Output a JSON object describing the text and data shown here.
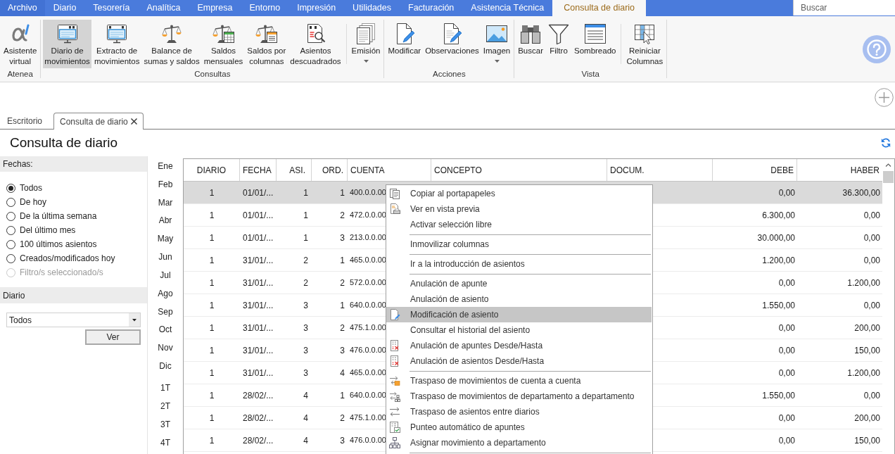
{
  "menu_bar": {
    "tabs": [
      {
        "label": "Archivo",
        "kind": "file",
        "selected": false
      },
      {
        "label": "Diario",
        "kind": "tab",
        "selected": false
      },
      {
        "label": "Tesorería",
        "kind": "tab",
        "selected": false
      },
      {
        "label": "Analítica",
        "kind": "tab",
        "selected": false
      },
      {
        "label": "Empresa",
        "kind": "tab",
        "selected": false
      },
      {
        "label": "Entorno",
        "kind": "tab",
        "selected": false
      },
      {
        "label": "Impresión",
        "kind": "tab",
        "selected": false
      },
      {
        "label": "Utilidades",
        "kind": "tab",
        "selected": false
      },
      {
        "label": "Facturación",
        "kind": "tab",
        "selected": false
      },
      {
        "label": "Asistencia Técnica",
        "kind": "tab",
        "selected": false
      },
      {
        "label": "Consulta de diario",
        "kind": "tab",
        "selected": true
      }
    ],
    "search": {
      "placeholder": "Buscar"
    }
  },
  "ribbon": {
    "groups": [
      {
        "label": "Atenea",
        "buttons": [
          {
            "kind": "button",
            "label": [
              "Asistente",
              "virtual"
            ],
            "selected": false,
            "dropdown": false
          }
        ]
      },
      {
        "label": "Consultas",
        "buttons": [
          {
            "kind": "button",
            "label": [
              "Diario de",
              "movimientos"
            ],
            "selected": true,
            "dropdown": false
          },
          {
            "kind": "button",
            "label": [
              "Extracto de",
              "movimientos"
            ],
            "selected": false,
            "dropdown": false
          },
          {
            "kind": "button",
            "label": [
              "Balance de",
              "sumas y saldos"
            ],
            "selected": false,
            "dropdown": false
          },
          {
            "kind": "button",
            "label": [
              "Saldos",
              "mensuales"
            ],
            "selected": false,
            "dropdown": false
          },
          {
            "kind": "button",
            "label": [
              "Saldos por",
              "columnas"
            ],
            "selected": false,
            "dropdown": false
          },
          {
            "kind": "button",
            "label": [
              "Asientos",
              "descuadrados"
            ],
            "selected": false,
            "dropdown": false
          },
          {
            "kind": "separator"
          },
          {
            "kind": "button",
            "label": [
              "Emisión"
            ],
            "selected": false,
            "dropdown": true
          }
        ]
      },
      {
        "label": "Acciones",
        "buttons": [
          {
            "kind": "button",
            "label": [
              "Modificar"
            ],
            "selected": false,
            "dropdown": false
          },
          {
            "kind": "button",
            "label": [
              "Observaciones"
            ],
            "selected": false,
            "dropdown": false
          },
          {
            "kind": "button",
            "label": [
              "Imagen"
            ],
            "selected": false,
            "dropdown": true
          }
        ]
      },
      {
        "label": "Vista",
        "buttons": [
          {
            "kind": "button",
            "label": [
              "Buscar"
            ],
            "selected": false,
            "dropdown": false
          },
          {
            "kind": "button",
            "label": [
              "Filtro"
            ],
            "selected": false,
            "dropdown": false
          },
          {
            "kind": "button",
            "label": [
              "Sombreado"
            ],
            "selected": false,
            "dropdown": false
          },
          {
            "kind": "separator"
          },
          {
            "kind": "button",
            "label": [
              "Reiniciar",
              "Columnas"
            ],
            "selected": false,
            "dropdown": false
          }
        ]
      }
    ]
  },
  "document_tabs": [
    {
      "label": "Escritorio",
      "selected": false,
      "closable": false
    },
    {
      "label": "Consulta de diario",
      "selected": true,
      "closable": true
    }
  ],
  "page": {
    "title": "Consulta de diario"
  },
  "filters": {
    "dates": {
      "heading": "Fechas:",
      "options": [
        {
          "label": "Todos",
          "selected": true,
          "disabled": false
        },
        {
          "label": "De hoy",
          "selected": false,
          "disabled": false
        },
        {
          "label": "De la última semana",
          "selected": false,
          "disabled": false
        },
        {
          "label": "Del último mes",
          "selected": false,
          "disabled": false
        },
        {
          "label": "100 últimos asientos",
          "selected": false,
          "disabled": false
        },
        {
          "label": "Creados/modificados hoy",
          "selected": false,
          "disabled": false
        },
        {
          "label": "Filtro/s seleccionado/s",
          "selected": false,
          "disabled": true
        }
      ]
    },
    "journal": {
      "heading": "Diario",
      "select": {
        "value": "Todos"
      },
      "button": "Ver"
    }
  },
  "periods": {
    "months": [
      "Ene",
      "Feb",
      "Mar",
      "Abr",
      "May",
      "Jun",
      "Jul",
      "Ago",
      "Sep",
      "Oct",
      "Nov",
      "Dic"
    ],
    "quarters": [
      "1T",
      "2T",
      "3T",
      "4T"
    ]
  },
  "table": {
    "columns": [
      "DIARIO",
      "FECHA",
      "ASI.",
      "ORD.",
      "CUENTA",
      "CONCEPTO",
      "DOCUM.",
      "DEBE",
      "HABER"
    ],
    "rows": [
      {
        "selected": true,
        "diario": "1",
        "fecha": "01/01/...",
        "asiento": "1",
        "orden": "1",
        "cuenta": "400.0.0.00",
        "debe": "0,00",
        "haber": "36.300,00"
      },
      {
        "selected": false,
        "diario": "1",
        "fecha": "01/01/...",
        "asiento": "1",
        "orden": "2",
        "cuenta": "472.0.0.00",
        "debe": "6.300,00",
        "haber": "0,00"
      },
      {
        "selected": false,
        "diario": "1",
        "fecha": "01/01/...",
        "asiento": "1",
        "orden": "3",
        "cuenta": "213.0.0.00",
        "debe": "30.000,00",
        "haber": "0,00"
      },
      {
        "selected": false,
        "diario": "1",
        "fecha": "31/01/...",
        "asiento": "2",
        "orden": "1",
        "cuenta": "465.0.0.00",
        "debe": "1.200,00",
        "haber": "0,00"
      },
      {
        "selected": false,
        "diario": "1",
        "fecha": "31/01/...",
        "asiento": "2",
        "orden": "2",
        "cuenta": "572.0.0.00",
        "debe": "0,00",
        "haber": "1.200,00"
      },
      {
        "selected": false,
        "diario": "1",
        "fecha": "31/01/...",
        "asiento": "3",
        "orden": "1",
        "cuenta": "640.0.0.00",
        "debe": "1.550,00",
        "haber": "0,00"
      },
      {
        "selected": false,
        "diario": "1",
        "fecha": "31/01/...",
        "asiento": "3",
        "orden": "2",
        "cuenta": "475.1.0.00",
        "debe": "0,00",
        "haber": "200,00"
      },
      {
        "selected": false,
        "diario": "1",
        "fecha": "31/01/...",
        "asiento": "3",
        "orden": "3",
        "cuenta": "476.0.0.00",
        "debe": "0,00",
        "haber": "150,00"
      },
      {
        "selected": false,
        "diario": "1",
        "fecha": "31/01/...",
        "asiento": "3",
        "orden": "4",
        "cuenta": "465.0.0.00",
        "debe": "0,00",
        "haber": "1.200,00"
      },
      {
        "selected": false,
        "diario": "1",
        "fecha": "28/02/...",
        "asiento": "4",
        "orden": "1",
        "cuenta": "640.0.0.00",
        "debe": "1.550,00",
        "haber": "0,00"
      },
      {
        "selected": false,
        "diario": "1",
        "fecha": "28/02/...",
        "asiento": "4",
        "orden": "2",
        "cuenta": "475.1.0.00",
        "debe": "0,00",
        "haber": "200,00"
      },
      {
        "selected": false,
        "diario": "1",
        "fecha": "28/02/...",
        "asiento": "4",
        "orden": "3",
        "cuenta": "476.0.0.00",
        "debe": "0,00",
        "haber": "150,00"
      }
    ]
  },
  "context_menu": {
    "items": [
      {
        "kind": "item",
        "label": "Copiar al portapapeles",
        "highlighted": false
      },
      {
        "kind": "item",
        "label": "Ver en vista previa",
        "highlighted": false
      },
      {
        "kind": "item",
        "label": "Activar selección libre",
        "highlighted": false
      },
      {
        "kind": "separator"
      },
      {
        "kind": "item",
        "label": "Inmovilizar columnas",
        "highlighted": false
      },
      {
        "kind": "separator"
      },
      {
        "kind": "item",
        "label": "Ir a la introducción de asientos",
        "highlighted": false
      },
      {
        "kind": "separator"
      },
      {
        "kind": "item",
        "label": "Anulación de apunte",
        "highlighted": false
      },
      {
        "kind": "item",
        "label": "Anulación de asiento",
        "highlighted": false
      },
      {
        "kind": "item",
        "label": "Modificación de asiento",
        "highlighted": true
      },
      {
        "kind": "item",
        "label": "Consultar el historial del asiento",
        "highlighted": false
      },
      {
        "kind": "item",
        "label": "Anulación de apuntes Desde/Hasta",
        "highlighted": false
      },
      {
        "kind": "item",
        "label": "Anulación de asientos Desde/Hasta",
        "highlighted": false
      },
      {
        "kind": "separator"
      },
      {
        "kind": "item",
        "label": "Traspaso de movimientos de cuenta a cuenta",
        "highlighted": false
      },
      {
        "kind": "item",
        "label": "Traspaso de movimientos de departamento a departamento",
        "highlighted": false
      },
      {
        "kind": "item",
        "label": "Traspaso de asientos entre diarios",
        "highlighted": false
      },
      {
        "kind": "item",
        "label": "Punteo automático de apuntes",
        "highlighted": false
      },
      {
        "kind": "item",
        "label": "Asignar movimiento a departamento",
        "highlighted": false
      },
      {
        "kind": "separator"
      }
    ]
  }
}
